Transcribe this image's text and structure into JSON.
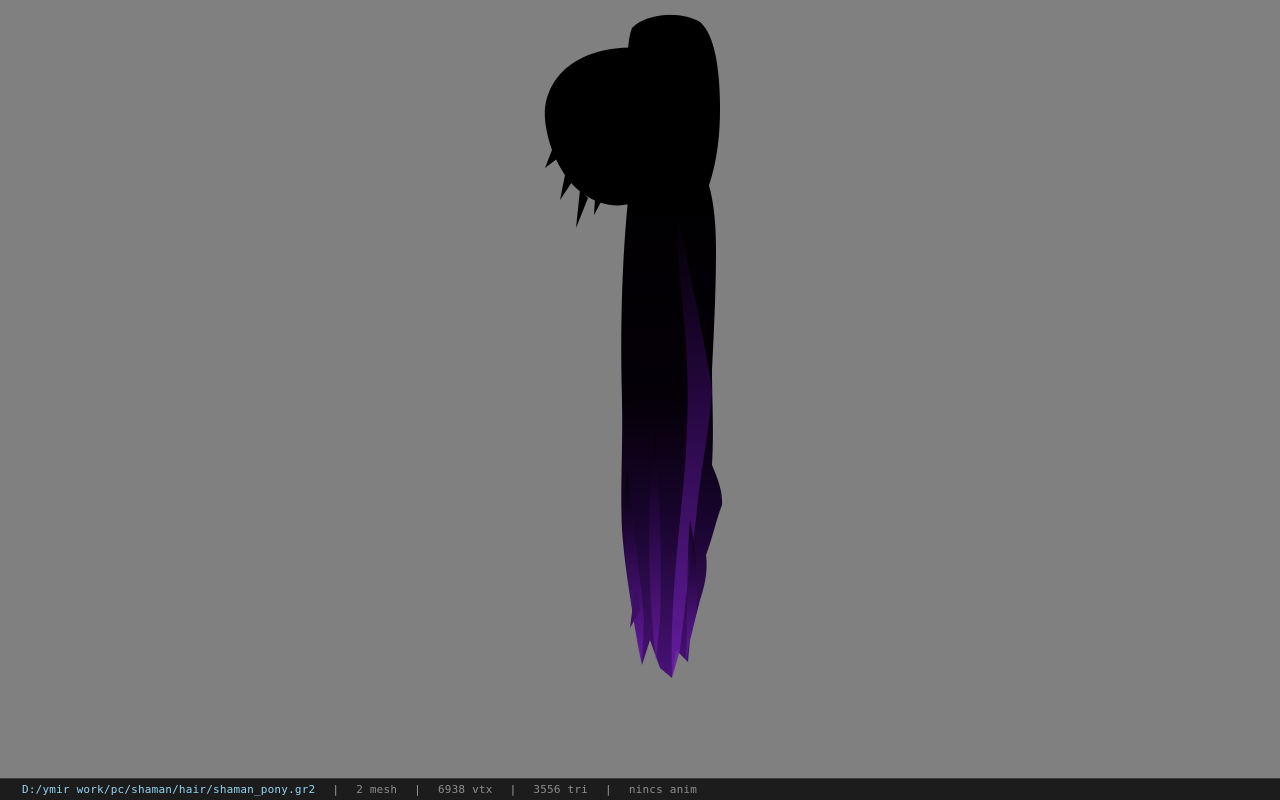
{
  "viewport": {
    "background_color": "#808080",
    "model_colors": {
      "hair_dark": "#000000",
      "hair_tint": "#5a1a8a"
    }
  },
  "status_bar": {
    "file_path": "D:/ymir work/pc/shaman/hair/shaman_pony.gr2",
    "mesh_count": "2 mesh",
    "vertex_count": "6938 vtx",
    "triangle_count": "3556 tri",
    "anim_status": "nincs anim",
    "separator": "|",
    "path_color": "#8fd0ec",
    "stat_color": "#8c8c8c",
    "background_color": "#1c1c1c"
  }
}
